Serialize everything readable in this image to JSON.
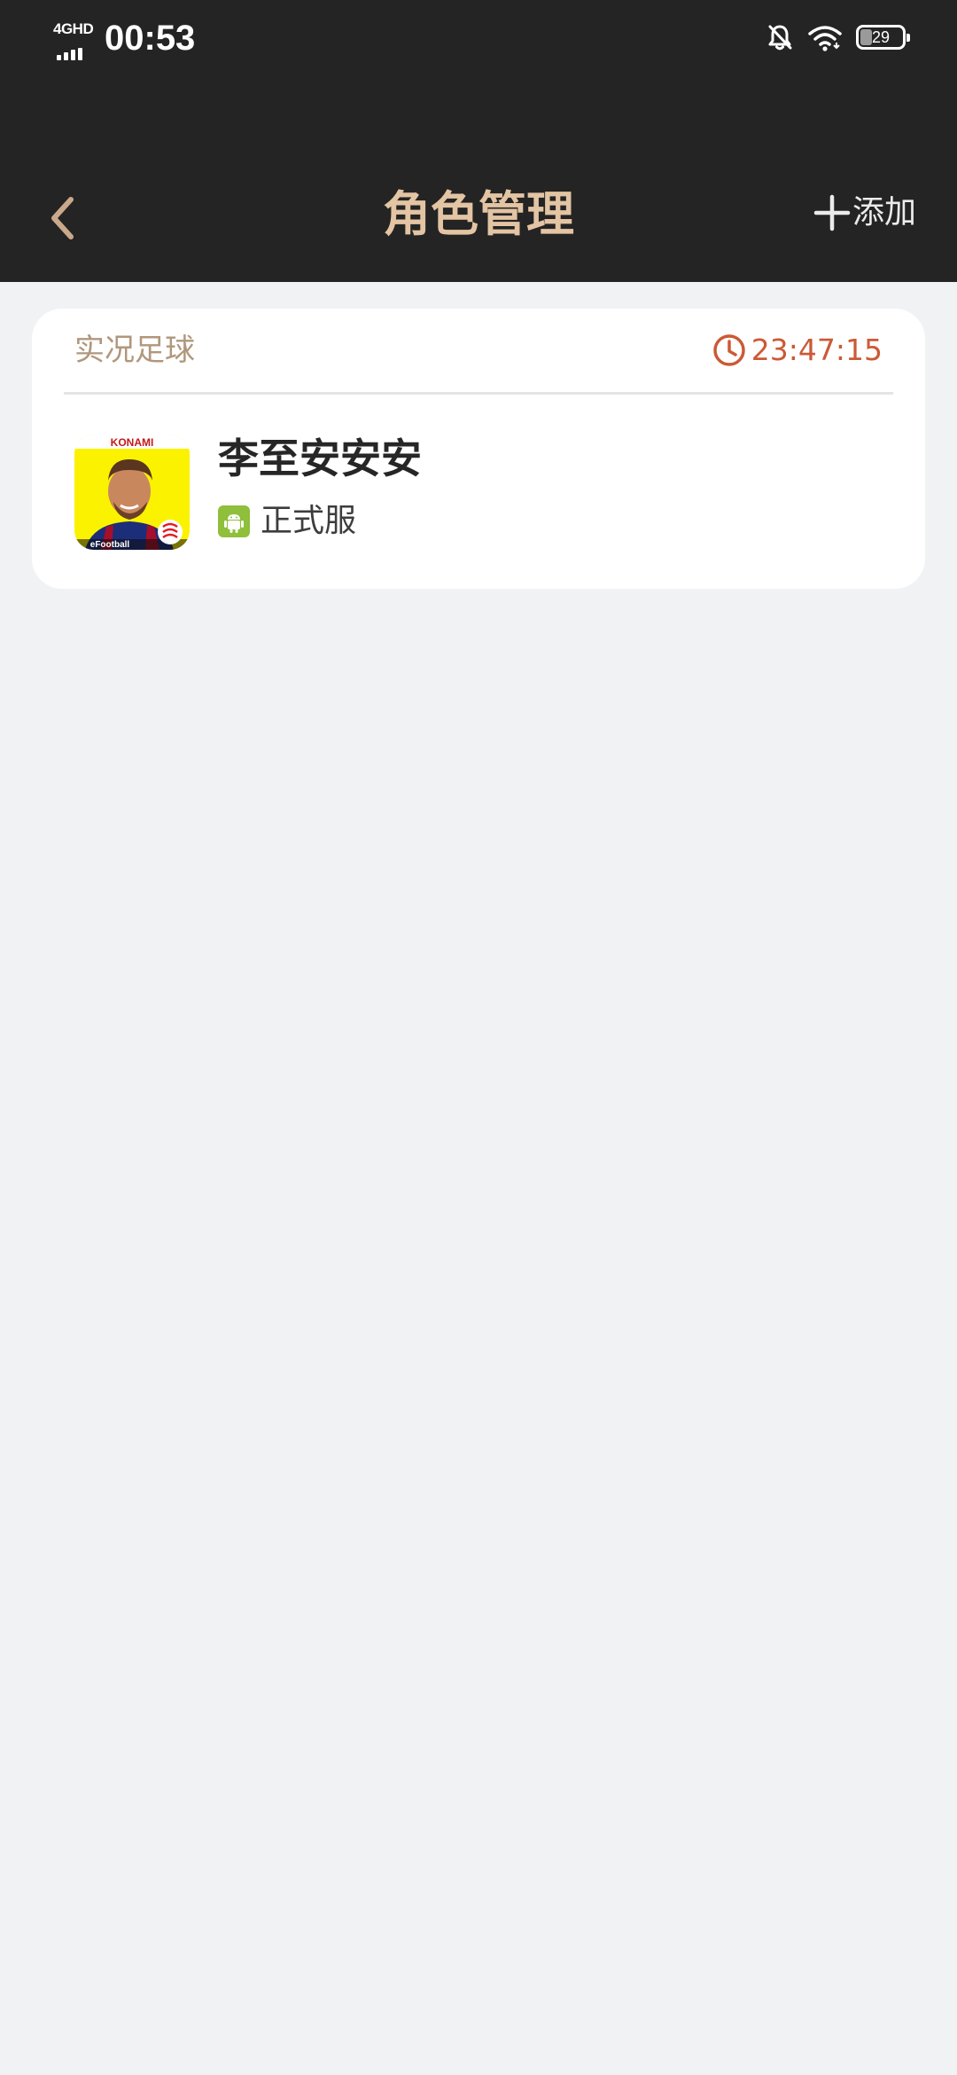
{
  "status_bar": {
    "network": "4GHD",
    "time": "00:53",
    "battery": "29",
    "battery_level": 0.29,
    "icons": [
      "signal-icon",
      "bell-off-icon",
      "wifi-icon",
      "battery-icon"
    ]
  },
  "header": {
    "back_icon": "chevron-left-icon",
    "title": "角色管理",
    "add_icon": "plus-icon",
    "add_label": "添加"
  },
  "card": {
    "game_name": "实况足球",
    "timer_icon": "clock-icon",
    "countdown": "23:47:15",
    "game_icon": {
      "brand_text": "KONAMI",
      "footer_text": "eFootball"
    },
    "role_name": "李至安安安",
    "platform_icon": "android-icon",
    "server": "正式服"
  },
  "colors": {
    "header_bg": "#242424",
    "page_bg": "#f1f2f4",
    "title": "#e3c4a3",
    "game_name": "#b0977c",
    "countdown": "#cb5a36",
    "android_badge": "#8fbf3b"
  }
}
